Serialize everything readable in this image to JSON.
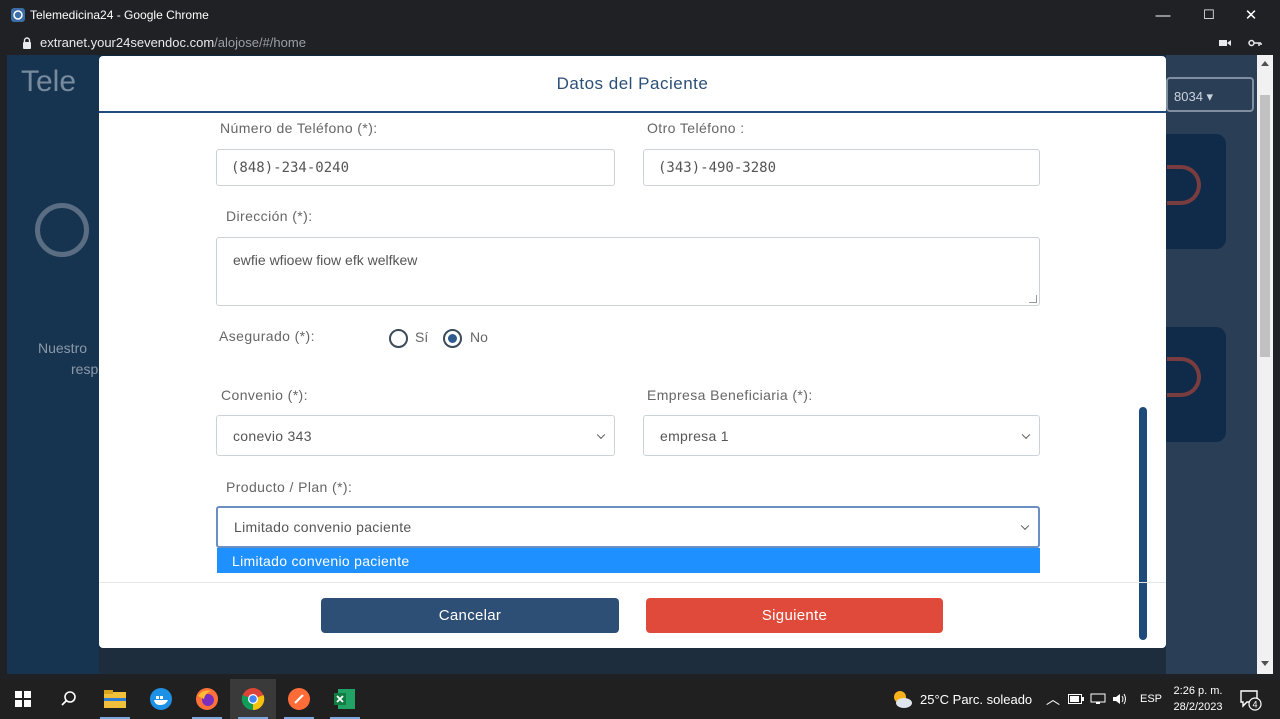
{
  "window": {
    "title": "Telemedicina24 - Google Chrome",
    "controls": {
      "minimize": "—",
      "maximize": "☐",
      "close": "✕"
    }
  },
  "address": {
    "host": "extranet.your24sevendoc.com",
    "path": "/alojose/#/home"
  },
  "background": {
    "logo_text": "Tele",
    "nuestro_line1": "Nuestro",
    "nuestro_line2": "resp",
    "selector_text": "8034 ▾"
  },
  "modal": {
    "title": "Datos del Paciente",
    "fields": {
      "telefono": {
        "label": "Número de Teléfono (*):",
        "value": "(848)-234-0240"
      },
      "otro_telefono": {
        "label": "Otro Teléfono :",
        "value": "(343)-490-3280"
      },
      "direccion": {
        "label": "Dirección (*):",
        "value": "ewfie wfioew fiow efk welfkew"
      },
      "asegurado": {
        "label": "Asegurado (*):",
        "options": [
          {
            "label": "Sí",
            "checked": false
          },
          {
            "label": "No",
            "checked": true
          }
        ]
      },
      "convenio": {
        "label": "Convenio (*):",
        "value": "conevio 343"
      },
      "empresa": {
        "label": "Empresa Beneficiaria (*):",
        "value": "empresa 1"
      },
      "producto": {
        "label": "Producto / Plan (*):",
        "value": "Limitado convenio paciente",
        "dropdown_option": "Limitado convenio paciente"
      }
    },
    "buttons": {
      "cancel": "Cancelar",
      "next": "Siguiente"
    },
    "colors": {
      "cancel": "#2d4e75",
      "next": "#e04a3a",
      "title": "#2c4f78",
      "option_highlight": "#1e90ff"
    }
  },
  "taskbar": {
    "weather": "25°C  Parc. soleado",
    "language": "ESP",
    "time": "2:26 p. m.",
    "date": "28/2/2023",
    "notifications": "4",
    "icons": [
      "windows-start-icon",
      "search-icon",
      "file-explorer-icon",
      "docker-icon",
      "firefox-icon",
      "chrome-icon",
      "postman-icon",
      "excel-icon"
    ]
  }
}
